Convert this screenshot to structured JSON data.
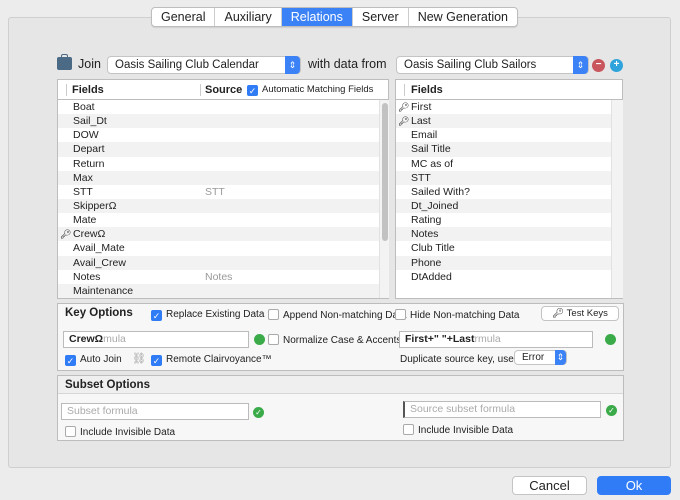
{
  "tabs": [
    {
      "label": "General"
    },
    {
      "label": "Auxiliary"
    },
    {
      "label": "Relations",
      "active": true
    },
    {
      "label": "Server"
    },
    {
      "label": "New Generation"
    }
  ],
  "join": {
    "label": "Join",
    "table": "Oasis Sailing Club Calendar",
    "with_label": "with data from",
    "source_table": "Oasis Sailing Club Sailors"
  },
  "left_table": {
    "col_fields": "Fields",
    "col_source": "Source",
    "auto_match_label": "Automatic Matching Fields",
    "auto_match_checked": true,
    "rows": [
      {
        "field": "Boat",
        "source": ""
      },
      {
        "field": "Sail_Dt",
        "source": ""
      },
      {
        "field": "DOW",
        "source": ""
      },
      {
        "field": "Depart",
        "source": ""
      },
      {
        "field": "Return",
        "source": ""
      },
      {
        "field": "Max",
        "source": ""
      },
      {
        "field": "STT",
        "source": "STT"
      },
      {
        "field": "SkipperΩ",
        "source": ""
      },
      {
        "field": "Mate",
        "source": ""
      },
      {
        "field": "CrewΩ",
        "source": "",
        "key": true
      },
      {
        "field": "Avail_Mate",
        "source": ""
      },
      {
        "field": "Avail_Crew",
        "source": ""
      },
      {
        "field": "Notes",
        "source": "Notes"
      },
      {
        "field": "Maintenance",
        "source": ""
      }
    ]
  },
  "right_table": {
    "col_fields": "Fields",
    "rows": [
      {
        "field": "First",
        "key": true
      },
      {
        "field": "Last",
        "key": true
      },
      {
        "field": "Email"
      },
      {
        "field": "Sail Title"
      },
      {
        "field": "MC as of"
      },
      {
        "field": "STT"
      },
      {
        "field": "Sailed With?"
      },
      {
        "field": "Dt_Joined"
      },
      {
        "field": "Rating"
      },
      {
        "field": "Notes"
      },
      {
        "field": "Club Title"
      },
      {
        "field": "Phone"
      },
      {
        "field": "DtAdded"
      }
    ]
  },
  "key_options": {
    "title": "Key Options",
    "replace_label": "Replace Existing Data",
    "replace_checked": true,
    "append_label": "Append Non-matching Data",
    "append_checked": false,
    "hide_label": "Hide Non-matching Data",
    "hide_checked": false,
    "test_keys_label": "Test Keys",
    "key_formula": "CrewΩ",
    "key_placeholder": "mula",
    "normalize_label": "Normalize Case & Accents",
    "normalize_checked": false,
    "source_key_formula": "First+\" \"+Last",
    "source_key_placeholder": "rmula",
    "auto_join_label": "Auto Join",
    "auto_join_checked": true,
    "clairvoyance_label": "Remote Clairvoyance™",
    "clairvoyance_checked": true,
    "duplicate_label": "Duplicate source key, use:",
    "duplicate_value": "Error"
  },
  "subset_options": {
    "title": "Subset Options",
    "subset_placeholder": "Subset formula",
    "source_subset_placeholder": "Source subset formula",
    "include_invisible_label": "Include Invisible Data",
    "include_invisible_checked": false,
    "source_include_invisible_label": "Include Invisible Data",
    "source_include_invisible_checked": false
  },
  "buttons": {
    "cancel": "Cancel",
    "ok": "Ok"
  },
  "colors": {
    "accent": "#3b82f6",
    "valid": "#3bab4a",
    "remove": "#c9555d",
    "add": "#2ea3dc"
  }
}
